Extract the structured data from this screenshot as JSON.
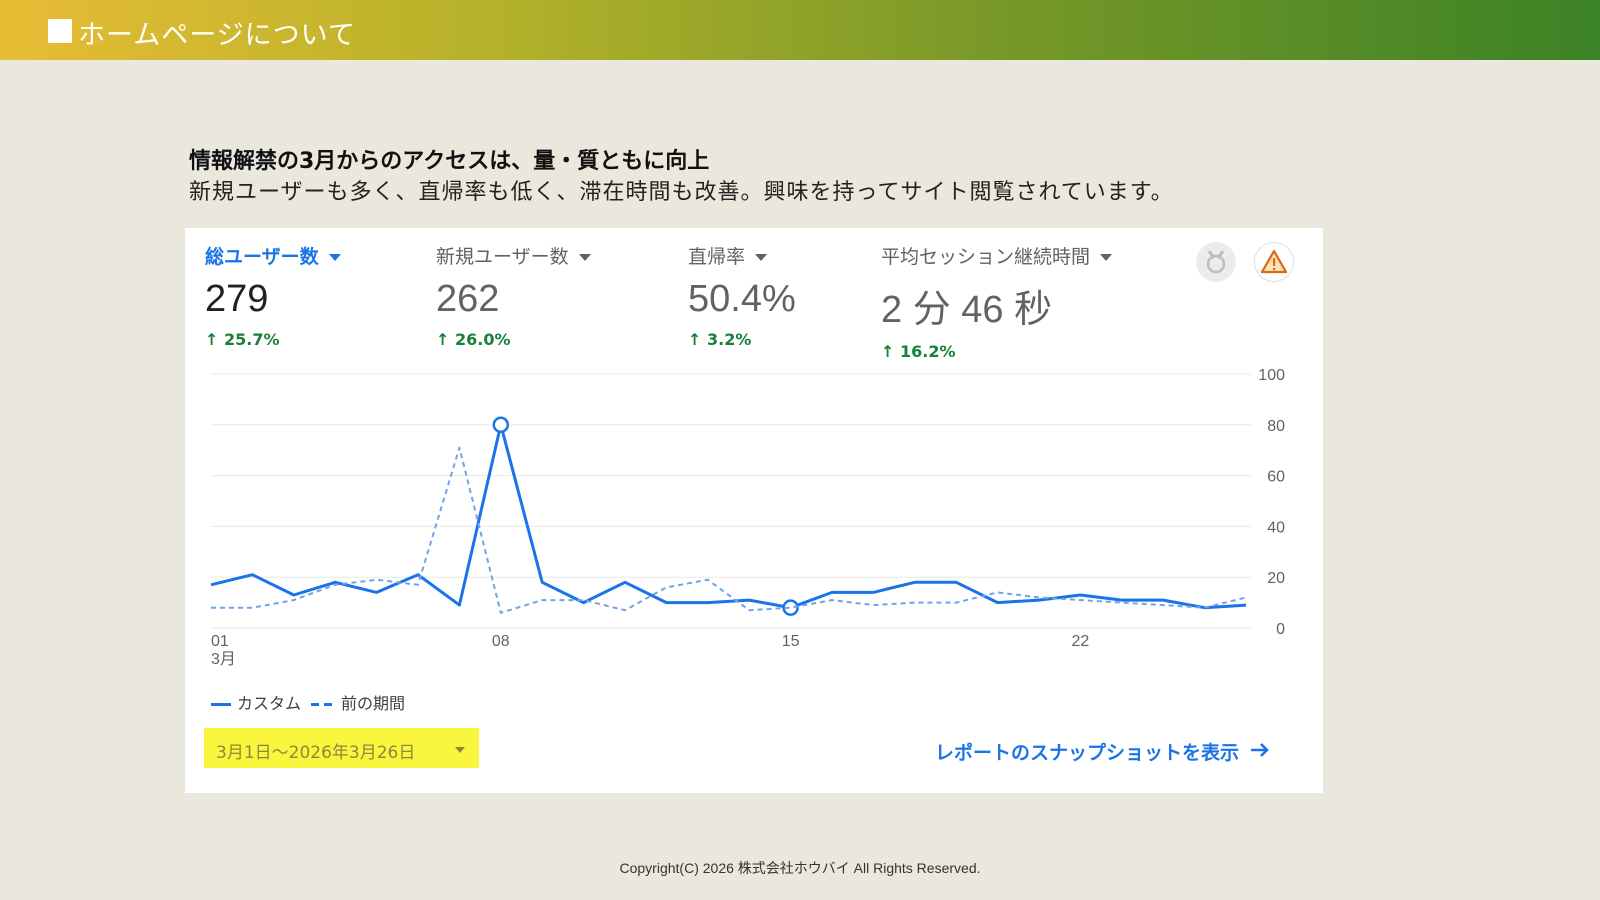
{
  "banner": {
    "title": "ホームページについて"
  },
  "headline": "情報解禁の3月からのアクセスは、量・質ともに向上",
  "subline": "新規ユーザーも多く、直帰率も低く、滞在時間も改善。興味を持ってサイト閲覧されています。",
  "metrics": [
    {
      "label": "総ユーザー数",
      "value": "279",
      "change": "25.7%"
    },
    {
      "label": "新規ユーザー数",
      "value": "262",
      "change": "26.0%"
    },
    {
      "label": "直帰率",
      "value": "50.4%",
      "change": "3.2%"
    },
    {
      "label": "平均セッション継続時間",
      "value": "2 分 46 秒",
      "change": "16.2%"
    }
  ],
  "icons": [
    "badge-icon",
    "warning-icon",
    "arrow-up-icon",
    "chevron-down-icon",
    "arrow-right-icon"
  ],
  "colors": {
    "primary": "#1a73e8",
    "positive": "#188038",
    "highlight": "#f8f63d"
  },
  "chart_data": {
    "type": "line",
    "x": [
      1,
      2,
      3,
      4,
      5,
      6,
      7,
      8,
      9,
      10,
      11,
      12,
      13,
      14,
      15,
      16,
      17,
      18,
      19,
      20,
      21,
      22,
      23,
      24,
      25,
      26
    ],
    "x_ticks": [
      {
        "x": 1,
        "label": "01",
        "sub": "3月"
      },
      {
        "x": 8,
        "label": "08",
        "sub": ""
      },
      {
        "x": 15,
        "label": "15",
        "sub": ""
      },
      {
        "x": 22,
        "label": "22",
        "sub": ""
      }
    ],
    "ylim": [
      0,
      100
    ],
    "y_ticks": [
      0,
      20,
      40,
      60,
      80,
      100
    ],
    "y_axis_side": "right",
    "grid": true,
    "series": [
      {
        "name": "カスタム",
        "style": "solid",
        "values": [
          17,
          21,
          13,
          18,
          14,
          21,
          9,
          80,
          18,
          10,
          18,
          10,
          10,
          11,
          8,
          14,
          14,
          18,
          18,
          10,
          11,
          13,
          11,
          11,
          8,
          9
        ],
        "markers": [
          8,
          15
        ]
      },
      {
        "name": "前の期間",
        "style": "dashed",
        "values": [
          8,
          8,
          11,
          17,
          19,
          17,
          71,
          6,
          11,
          11,
          7,
          16,
          19,
          7,
          8,
          11,
          9,
          10,
          10,
          14,
          12,
          11,
          10,
          9,
          8,
          12
        ]
      }
    ],
    "legend": {
      "placement": "bottom-left"
    }
  },
  "controls": {
    "date_range": "3月1日〜2026年3月26日",
    "report_link": "レポートのスナップショットを表示"
  },
  "footer": "Copyright(C) 2026 株式会社ホウバイ All Rights Reserved."
}
